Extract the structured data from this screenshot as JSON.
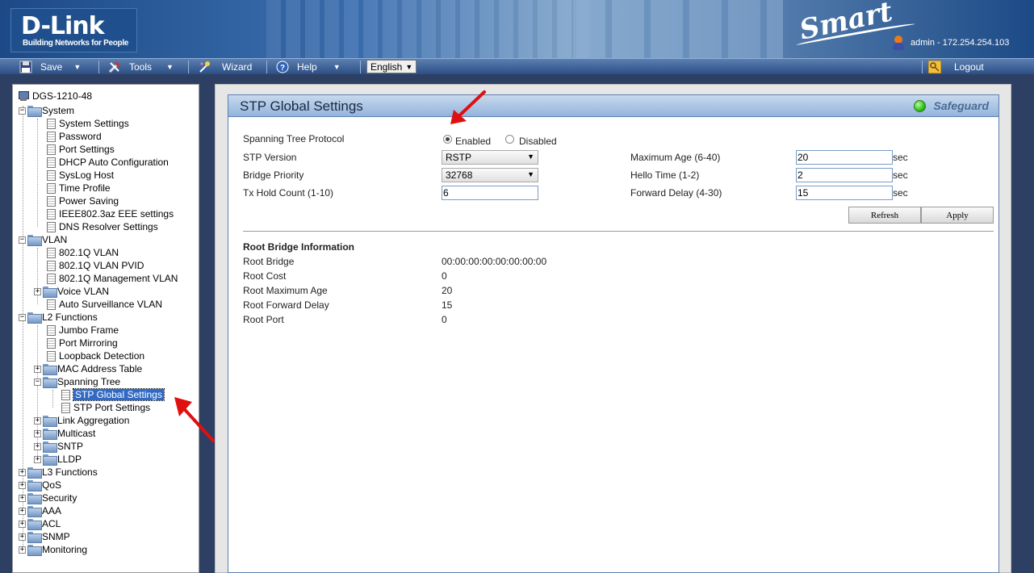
{
  "header": {
    "brand": "D-Link",
    "tagline": "Building Networks for People",
    "product": "Smart",
    "user_info": "admin - 172.254.254.103"
  },
  "menubar": {
    "save": "Save",
    "tools": "Tools",
    "wizard": "Wizard",
    "help": "Help",
    "language": "English",
    "logout": "Logout"
  },
  "tree": {
    "root": "DGS-1210-48",
    "system": "System",
    "system_items": [
      "System Settings",
      "Password",
      "Port Settings",
      "DHCP Auto Configuration",
      "SysLog Host",
      "Time Profile",
      "Power Saving",
      "IEEE802.3az EEE settings",
      "DNS Resolver Settings"
    ],
    "vlan": "VLAN",
    "vlan_items": [
      "802.1Q VLAN",
      "802.1Q VLAN PVID",
      "802.1Q Management VLAN",
      "Voice VLAN",
      "Auto Surveillance VLAN"
    ],
    "l2": "L2 Functions",
    "l2_items": [
      "Jumbo Frame",
      "Port Mirroring",
      "Loopback Detection",
      "MAC Address Table",
      "Spanning Tree"
    ],
    "stp_items": [
      "STP Global Settings",
      "STP Port Settings"
    ],
    "l2_more": [
      "Link Aggregation",
      "Multicast",
      "SNTP",
      "LLDP"
    ],
    "top_more": [
      "L3 Functions",
      "QoS",
      "Security",
      "AAA",
      "ACL",
      "SNMP",
      "Monitoring"
    ]
  },
  "panel": {
    "title": "STP Global Settings",
    "safeguard": "Safeguard",
    "stp_protocol_label": "Spanning Tree Protocol",
    "enabled": "Enabled",
    "disabled": "Disabled",
    "stp_version_label": "STP Version",
    "stp_version": "RSTP",
    "bridge_priority_label": "Bridge Priority",
    "bridge_priority": "32768",
    "tx_hold_label": "Tx Hold Count (1-10)",
    "tx_hold": "6",
    "max_age_label": "Maximum Age (6-40)",
    "max_age": "20",
    "hello_label": "Hello Time (1-2)",
    "hello": "2",
    "fwd_delay_label": "Forward Delay (4-30)",
    "fwd_delay": "15",
    "unit": "sec",
    "refresh": "Refresh",
    "apply": "Apply",
    "root_info_title": "Root Bridge Information",
    "root_rows": [
      {
        "label": "Root Bridge",
        "value": "00:00:00:00:00:00:00:00"
      },
      {
        "label": "Root Cost",
        "value": "0"
      },
      {
        "label": "Root Maximum Age",
        "value": "20"
      },
      {
        "label": "Root Forward Delay",
        "value": "15"
      },
      {
        "label": "Root Port",
        "value": "0"
      }
    ]
  }
}
